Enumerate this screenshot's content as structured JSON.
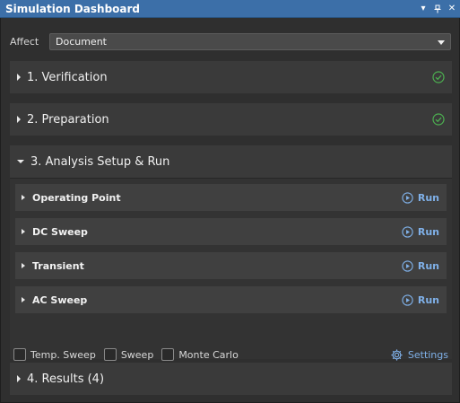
{
  "window": {
    "title": "Simulation Dashboard",
    "controls": [
      "dropdown-icon",
      "pin-icon",
      "close-icon"
    ]
  },
  "affect": {
    "label": "Affect",
    "value": "Document"
  },
  "sections": {
    "verification": {
      "title": "1. Verification",
      "status": "ok"
    },
    "preparation": {
      "title": "2. Preparation",
      "status": "ok"
    },
    "setup": {
      "title": "3. Analysis Setup & Run"
    },
    "results": {
      "title": "4. Results (4)"
    }
  },
  "analyses": [
    {
      "name": "Operating Point",
      "action": "Run"
    },
    {
      "name": "DC Sweep",
      "action": "Run"
    },
    {
      "name": "Transient",
      "action": "Run"
    },
    {
      "name": "AC Sweep",
      "action": "Run"
    }
  ],
  "options": {
    "temp_sweep": "Temp. Sweep",
    "sweep": "Sweep",
    "monte_carlo": "Monte Carlo",
    "settings": "Settings"
  },
  "colors": {
    "title_bar": "#3c6fa8",
    "accent_link": "#7fb0e8",
    "check_green": "#4caf50"
  }
}
